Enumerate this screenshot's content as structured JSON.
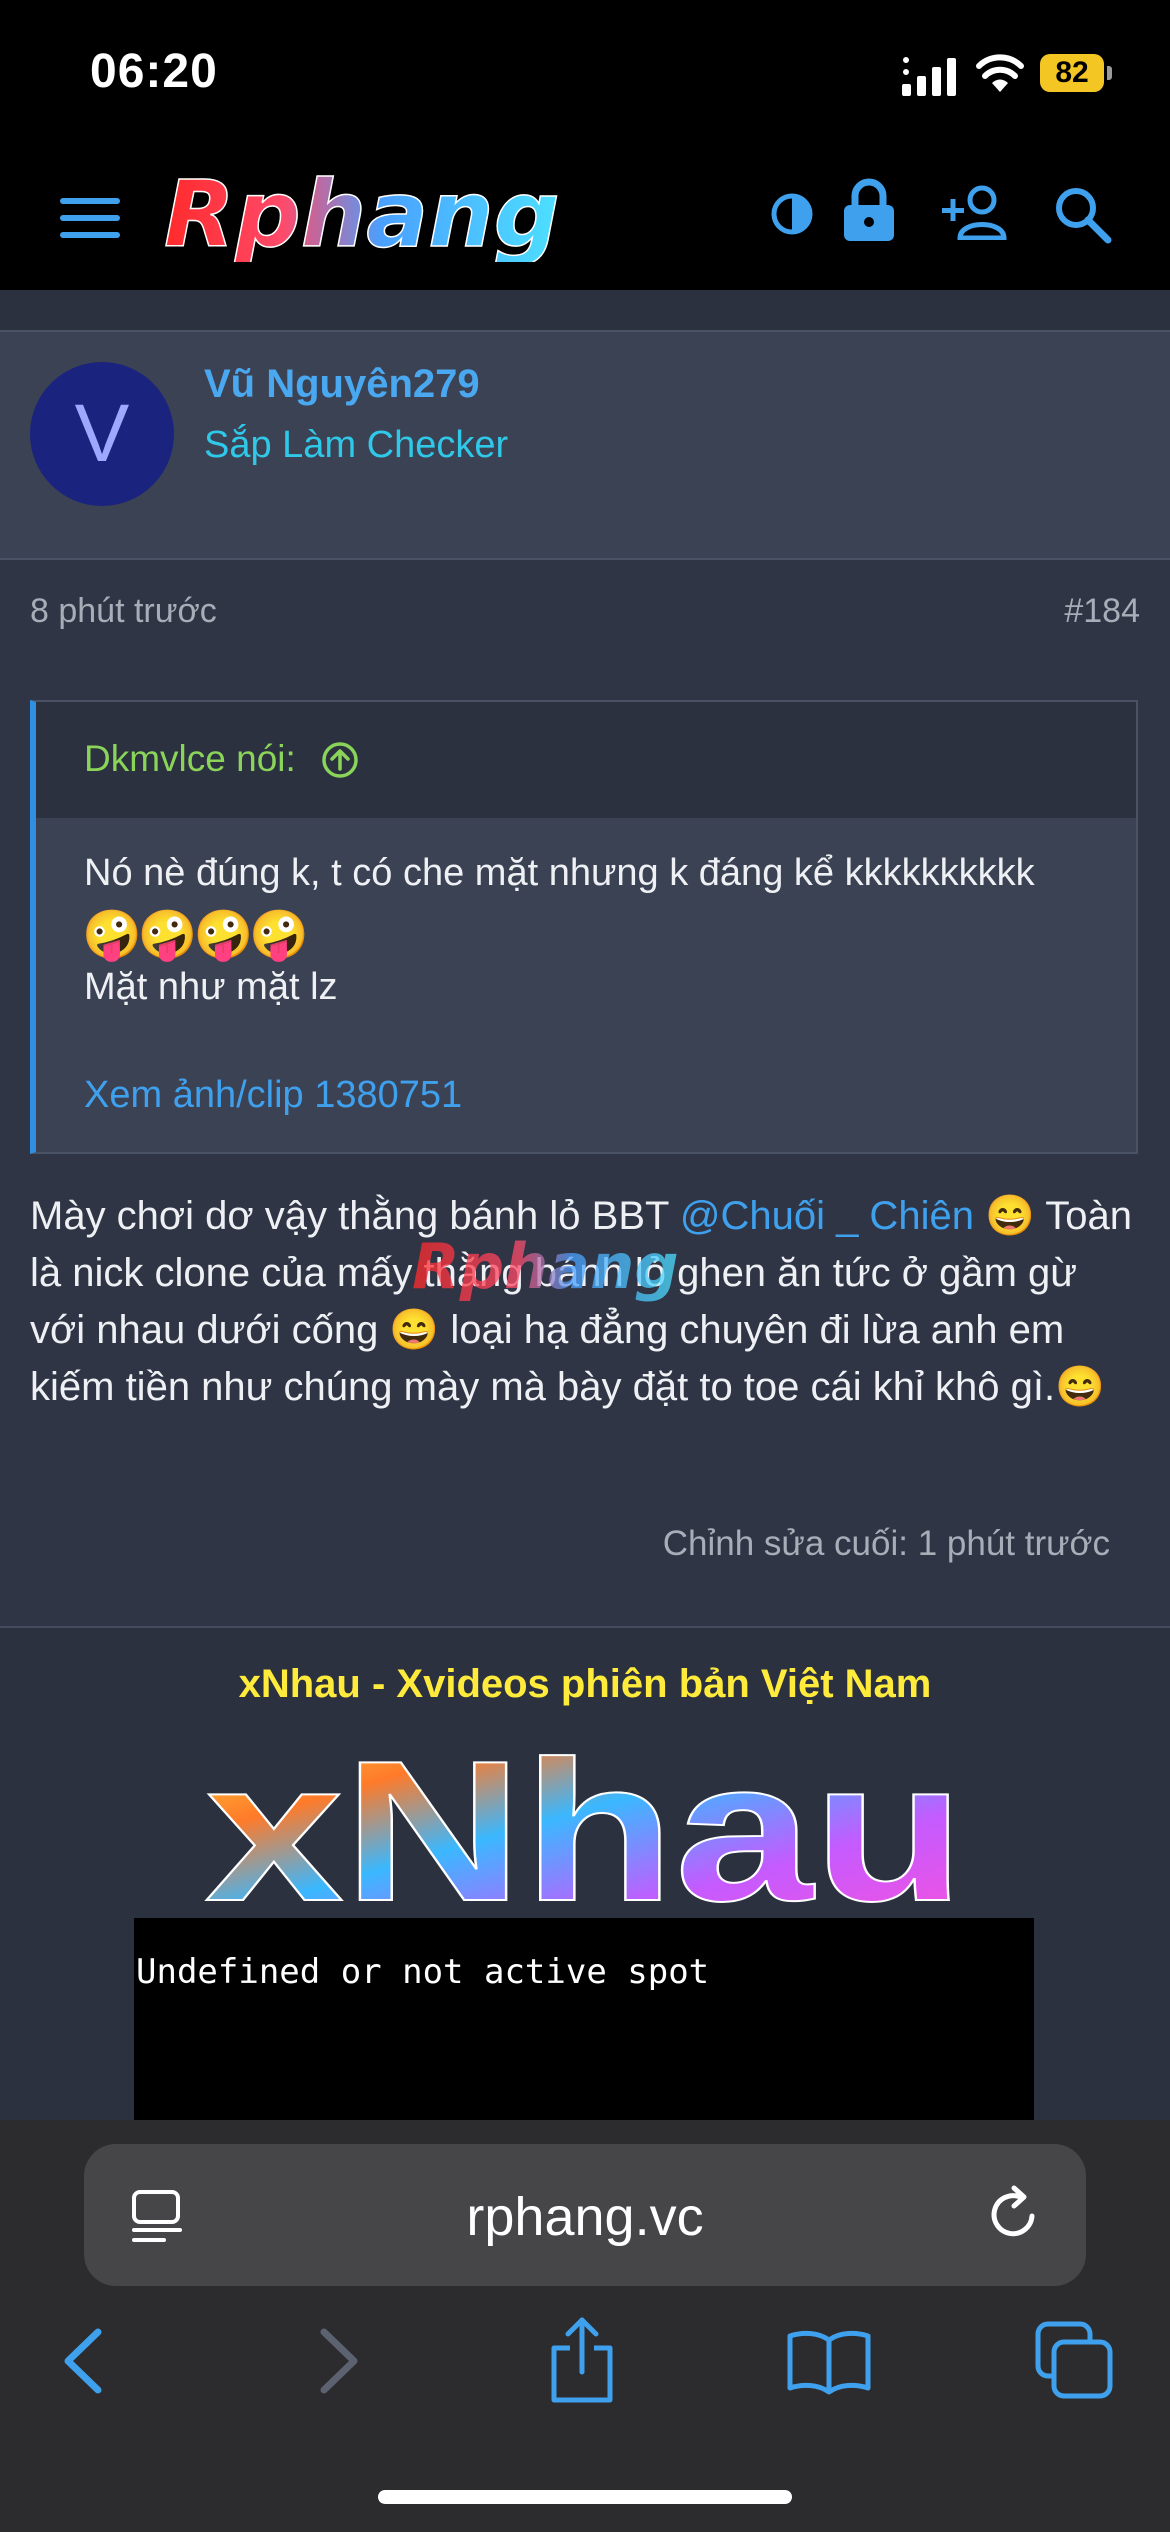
{
  "status_bar": {
    "time": "06:20",
    "battery": "82"
  },
  "header": {
    "logo_text": "Rphang"
  },
  "post": {
    "username": "Vũ Nguyên279",
    "user_title": "Sắp Làm Checker",
    "avatar_letter": "V",
    "time": "8 phút trước",
    "number": "#184",
    "quote": {
      "author": "Dkmvlce nói:",
      "line1": "Nó nè đúng k, t có che mặt nhưng k đáng kể kkkkkkkkkk",
      "emoji": "🤪🤪🤪🤪",
      "line2": "Mặt như mặt lz",
      "link": "Xem ảnh/clip 1380751"
    },
    "body": {
      "part1": "Mày chơi dơ vậy thằng bánh lỏ BBT ",
      "mention": "@Chuối _ Chiên",
      "part2": " 😄 Toàn là nick clone của mấy thằng bánh lỏ ghen ăn tức ở gầm gừ với nhau dưới cống 😄 loại hạ đẳng chuyên đi lừa anh em kiếm tiền như chúng mày mà bày đặt to toe cái khỉ khô gì.😄"
    },
    "watermark": "Rphang",
    "edited": "Chỉnh sửa cuối: 1 phút trước"
  },
  "ad": {
    "title": "xNhau - Xvideos phiên bản Việt Nam",
    "logo_text": "xNhau",
    "placeholder": "Undefined or not active spot"
  },
  "browser": {
    "url": "rphang.vc"
  },
  "colors": {
    "accent_blue": "#3fa1ee",
    "quote_author_green": "#8ad45a",
    "ad_title_yellow": "#ffeb3b",
    "battery_yellow": "#f3c623"
  }
}
